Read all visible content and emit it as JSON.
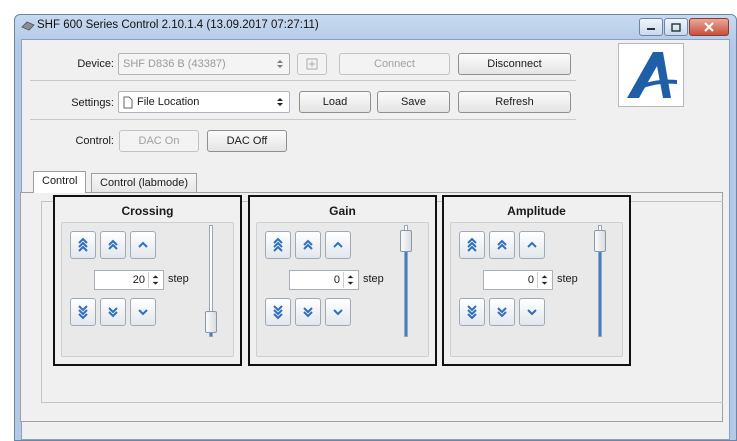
{
  "window": {
    "title": "SHF 600 Series Control 2.10.1.4 (13.09.2017 07:27:11)"
  },
  "device_row": {
    "label": "Device:",
    "device_value": "SHF D836 B (43387)",
    "connect_label": "Connect",
    "disconnect_label": "Disconnect"
  },
  "settings_row": {
    "label": "Settings:",
    "file_value": "File Location",
    "load_label": "Load",
    "save_label": "Save",
    "refresh_label": "Refresh"
  },
  "control_row": {
    "label": "Control:",
    "dac_on_label": "DAC On",
    "dac_off_label": "DAC Off"
  },
  "tabs": [
    {
      "label": "Control",
      "active": true
    },
    {
      "label": "Control (labmode)",
      "active": false
    }
  ],
  "groups": [
    {
      "title": "Crossing",
      "value": "20",
      "step_label": "step",
      "slider_level": 0.05
    },
    {
      "title": "Gain",
      "value": "0",
      "step_label": "step",
      "slider_level": 0.95
    },
    {
      "title": "Amplitude",
      "value": "0",
      "step_label": "step",
      "slider_level": 0.95
    }
  ],
  "colors": {
    "logo_blue": "#1f5fa8",
    "slider_fill": "#3d7fd6",
    "arrow_blue": "#2f6fc0"
  }
}
